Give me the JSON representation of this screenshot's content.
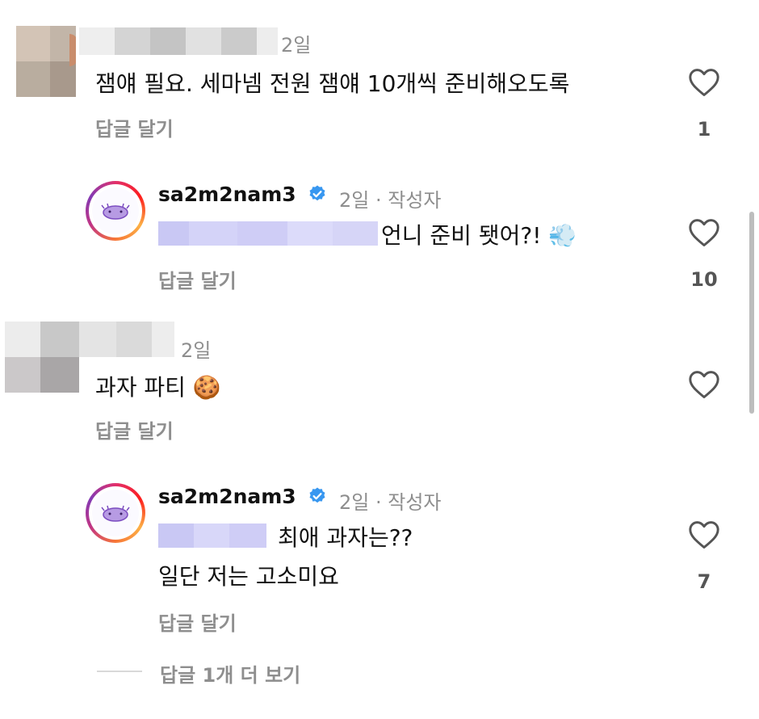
{
  "comments": [
    {
      "time": "2일",
      "text": "잼얘 필요. 세마넴 전원 잼얘 10개씩 준비해오도록",
      "reply_label": "답글 달기",
      "likes": "1"
    },
    {
      "username": "sa2m2nam3",
      "time_meta": "2일 · 작성자",
      "text": "언니 준비 됏어?!",
      "emoji": "💨",
      "reply_label": "답글 달기",
      "likes": "10"
    },
    {
      "time": "2일",
      "text": "과자 파티",
      "emoji": "🍪",
      "reply_label": "답글 달기",
      "likes": ""
    },
    {
      "username": "sa2m2nam3",
      "time_meta": "2일 · 작성자",
      "text_line1": "최애 과자는??",
      "text_line2": "일단 저는 고소미요",
      "reply_label": "답글 달기",
      "likes": "7"
    }
  ],
  "more_replies": "답글 1개 더 보기",
  "colors": {
    "meta": "#8e8e8e",
    "verified": "#3897f0",
    "ring_start": "#e1306c",
    "ring_end": "#fcaf45"
  },
  "icons": [
    "heart-icon",
    "verified-badge-icon",
    "avatar-icon"
  ]
}
